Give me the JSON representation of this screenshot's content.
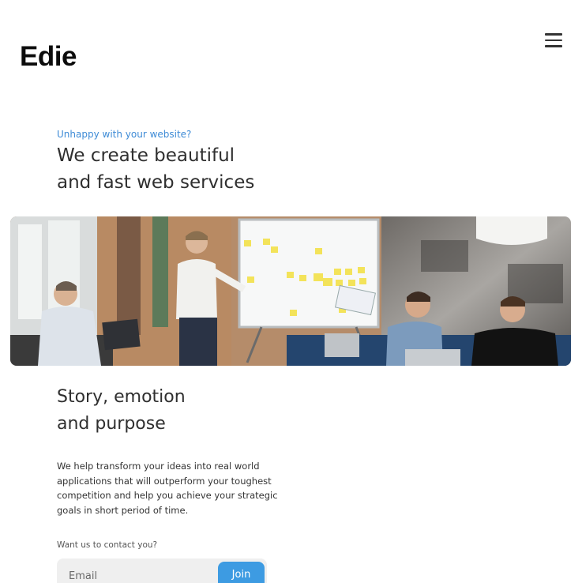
{
  "header": {
    "logo": "Edie",
    "menu_icon": "hamburger-menu-icon"
  },
  "hero": {
    "eyebrow": "Unhappy with your website?",
    "headline_line1": "We create beautiful",
    "headline_line2": "and fast web services",
    "image_alt": "Team meeting around a whiteboard covered in sticky notes"
  },
  "story": {
    "title_line1": "Story, emotion",
    "title_line2": "and purpose",
    "body": "We help transform your ideas into real world applications that will outperform your toughest competition and help you achieve your strategic goals in short period of time."
  },
  "contact": {
    "label": "Want us to contact you?",
    "email_placeholder": "Email",
    "join_label": "Join"
  },
  "colors": {
    "accent": "#3d9be2",
    "eyebrow": "#3e8bd6",
    "input_bg": "#efefef"
  }
}
